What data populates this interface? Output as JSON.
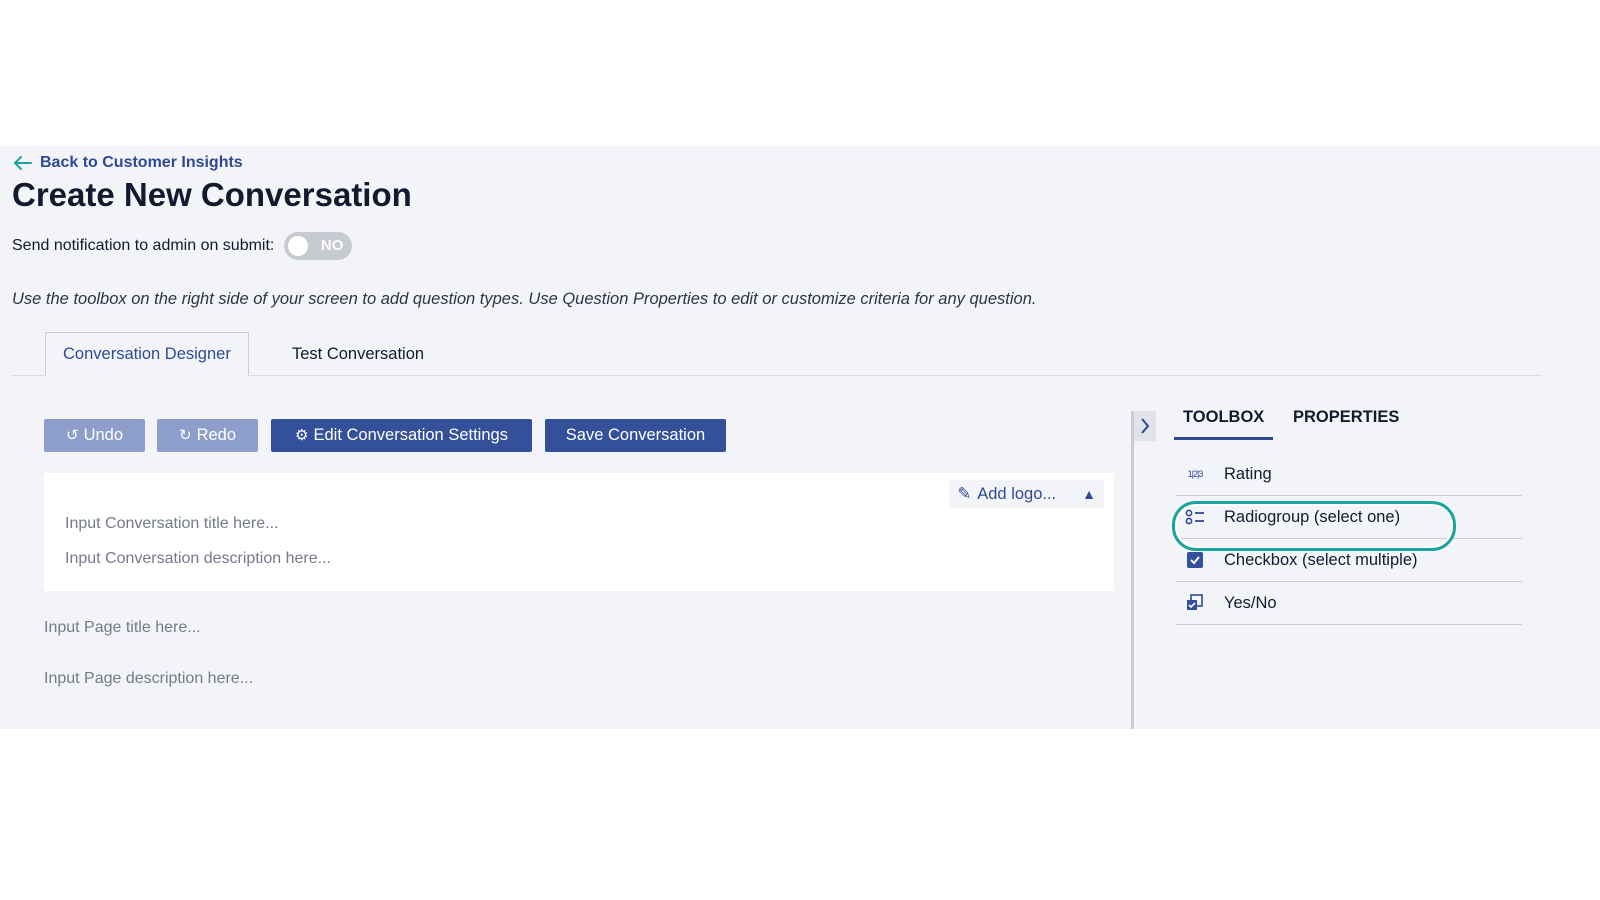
{
  "header": {
    "back_label": "Back to Customer Insights",
    "title": "Create New Conversation",
    "notify_label": "Send notification to admin on submit:",
    "notify_toggle": "NO",
    "hint": "Use the toolbox on the right side of your screen to add question types. Use Question Properties to edit or customize criteria for any question."
  },
  "tabs": [
    "Conversation Designer",
    "Test Conversation"
  ],
  "toolbar": {
    "undo": "Undo",
    "redo": "Redo",
    "settings": "Edit Conversation Settings",
    "save": "Save Conversation"
  },
  "designer": {
    "add_logo": "Add logo...",
    "title_placeholder": "Input Conversation title here...",
    "description_placeholder": "Input Conversation description here...",
    "page_title_placeholder": "Input Page title here...",
    "page_description_placeholder": "Input Page description here..."
  },
  "panel": {
    "tabs": [
      "TOOLBOX",
      "PROPERTIES"
    ],
    "items": [
      {
        "label": "Rating",
        "icon": "rating-icon",
        "icon_glyph": "1|2|3"
      },
      {
        "label": "Radiogroup (select one)",
        "icon": "radiogroup-icon"
      },
      {
        "label": "Checkbox (select multiple)",
        "icon": "checkbox-icon"
      },
      {
        "label": "Yes/No",
        "icon": "boolean-icon"
      }
    ]
  },
  "colors": {
    "accent": "#2f4a95",
    "button_primary": "#34509a",
    "button_disabled": "#8d9ecb",
    "highlight": "#1ba39c",
    "background": "#f3f4f8"
  }
}
